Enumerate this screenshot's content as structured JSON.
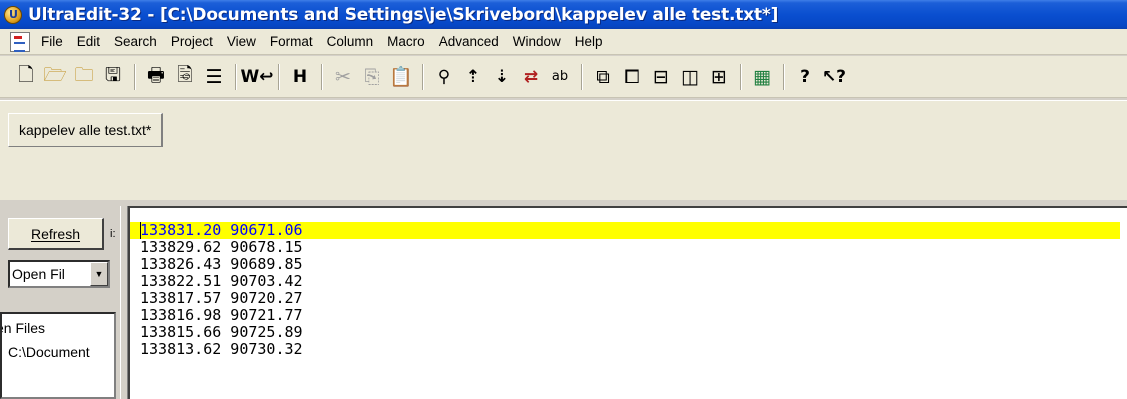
{
  "window": {
    "title": "UltraEdit-32 - [C:\\Documents and Settings\\je\\Skrivebord\\kappelev alle test.txt*]",
    "icon": "ultraedit-app-icon"
  },
  "menubar": {
    "items": [
      "File",
      "Edit",
      "Search",
      "Project",
      "View",
      "Format",
      "Column",
      "Macro",
      "Advanced",
      "Window",
      "Help"
    ]
  },
  "toolbar": {
    "buttons": [
      {
        "icon": "new-file-icon",
        "glyph": "🗋"
      },
      {
        "icon": "open-folder-icon",
        "glyph": "📂"
      },
      {
        "icon": "open-file-icon",
        "glyph": "📁"
      },
      {
        "icon": "save-icon",
        "glyph": "💾"
      },
      {
        "icon": "print-icon",
        "glyph": "🖶"
      },
      {
        "icon": "print-preview-icon",
        "glyph": "🔍"
      },
      {
        "icon": "page-setup-icon",
        "glyph": "≣"
      },
      {
        "icon": "word-wrap-icon",
        "glyph": "W↩"
      },
      {
        "icon": "hex-edit-icon",
        "glyph": "H"
      },
      {
        "icon": "cut-icon",
        "glyph": "✂"
      },
      {
        "icon": "copy-icon",
        "glyph": "⎘"
      },
      {
        "icon": "paste-icon",
        "glyph": "📋"
      },
      {
        "icon": "find-icon",
        "glyph": "🔭"
      },
      {
        "icon": "find-next-icon",
        "glyph": "⇡"
      },
      {
        "icon": "find-prev-icon",
        "glyph": "⇣"
      },
      {
        "icon": "replace-icon",
        "glyph": "⇄"
      },
      {
        "icon": "find-in-files-icon",
        "glyph": "ab"
      },
      {
        "icon": "tile-horizontal-icon",
        "glyph": "⧉"
      },
      {
        "icon": "cascade-icon",
        "glyph": "⧠"
      },
      {
        "icon": "split-horizontal-icon",
        "glyph": "⊟"
      },
      {
        "icon": "split-vertical-icon",
        "glyph": "◫"
      },
      {
        "icon": "window-list-icon",
        "glyph": "⊞"
      },
      {
        "icon": "ftp-icon",
        "glyph": "▦"
      },
      {
        "icon": "help-icon",
        "glyph": "?"
      },
      {
        "icon": "context-help-icon",
        "glyph": "↖?"
      }
    ]
  },
  "tabs": [
    {
      "label": "kappelev alle test.txt*"
    }
  ],
  "sidepanel": {
    "refresh_label": "Refresh",
    "combo_value": "Open Fil",
    "list_title": "en Files",
    "list_item": "C:\\Document",
    "dots": "i:"
  },
  "editor": {
    "lines": [
      "133831.20 90671.06",
      "133829.62 90678.15",
      "133826.43 90689.85",
      "133822.51 90703.42",
      "133817.57 90720.27",
      "133816.98 90721.77",
      "133815.66 90725.89",
      "133813.62 90730.32"
    ],
    "current_line": 1,
    "current_line_color": "#ffff00"
  }
}
